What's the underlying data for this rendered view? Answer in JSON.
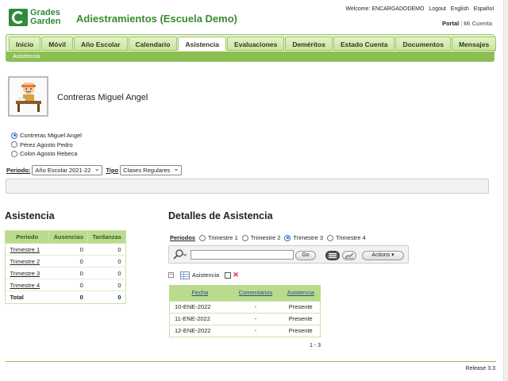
{
  "brand": {
    "logo_line1": "Grades",
    "logo_line2": "Garden"
  },
  "app_title": "Adiestramientos (Escuela Demo)",
  "topnav": {
    "welcome": "Welcome: ENCARGADODEMO",
    "logout": "Logout",
    "english": "English",
    "espanol": "Español"
  },
  "portal": {
    "portal": "Portal",
    "mi_cuenta": "Mi Cuenta"
  },
  "tabs": [
    "Inicio",
    "Móvil",
    "Año Escolar",
    "Calendario",
    "Asistencia",
    "Evaluaciones",
    "Deméritos",
    "Estado Cuenta",
    "Documentos",
    "Mensajes"
  ],
  "active_tab": "Asistencia",
  "subnav": "Asistencia",
  "student": {
    "name": "Contreras Miguel Angel"
  },
  "students": [
    {
      "label": "Contreras Miguel Angel",
      "selected": true
    },
    {
      "label": "Pérez Agosto Pedro",
      "selected": false
    },
    {
      "label": "Colon Agosto Rebeca",
      "selected": false
    }
  ],
  "filters": {
    "period_label": "Periodo:",
    "period_value": "Año Escolar 2021-22",
    "type_label": "Tipo",
    "type_value": "Clases Regulares"
  },
  "summary": {
    "title": "Asistencia",
    "headers": [
      "Periodo",
      "Ausencias",
      "Tardanzas"
    ],
    "rows": [
      [
        "Trimestre 1",
        "0",
        "0"
      ],
      [
        "Trimestre 2",
        "0",
        "0"
      ],
      [
        "Trimestre 3",
        "0",
        "0"
      ],
      [
        "Trimestre 4",
        "0",
        "0"
      ],
      [
        "Total",
        "0",
        "0"
      ]
    ]
  },
  "details": {
    "title": "Detalles de Asistencia",
    "periods_label": "Periodos",
    "periods": [
      {
        "label": "Trimestre 1",
        "selected": false
      },
      {
        "label": "Trimestre 2",
        "selected": false
      },
      {
        "label": "Trimestre 3",
        "selected": true
      },
      {
        "label": "Trimestre 4",
        "selected": false
      }
    ],
    "search_value": "",
    "go_label": "Go",
    "actions_label": "Actions ▾",
    "report_label": "Asistencia",
    "headers": [
      "Fecha",
      "Comentarios",
      "Asistencia"
    ],
    "rows": [
      [
        "10-ENE-2022",
        "-",
        "Presente"
      ],
      [
        "11-ENE-2022",
        "-",
        "Presente"
      ],
      [
        "12-ENE-2022",
        "-",
        "Presente"
      ]
    ],
    "pager": "1 - 3"
  },
  "footer": {
    "release": "Release 3.3"
  },
  "colors": {
    "brand_green": "#2e8b3a",
    "tab_green": "#c9e59d",
    "subnav_green": "#8cbf52",
    "header_green": "#b8dc8b"
  }
}
